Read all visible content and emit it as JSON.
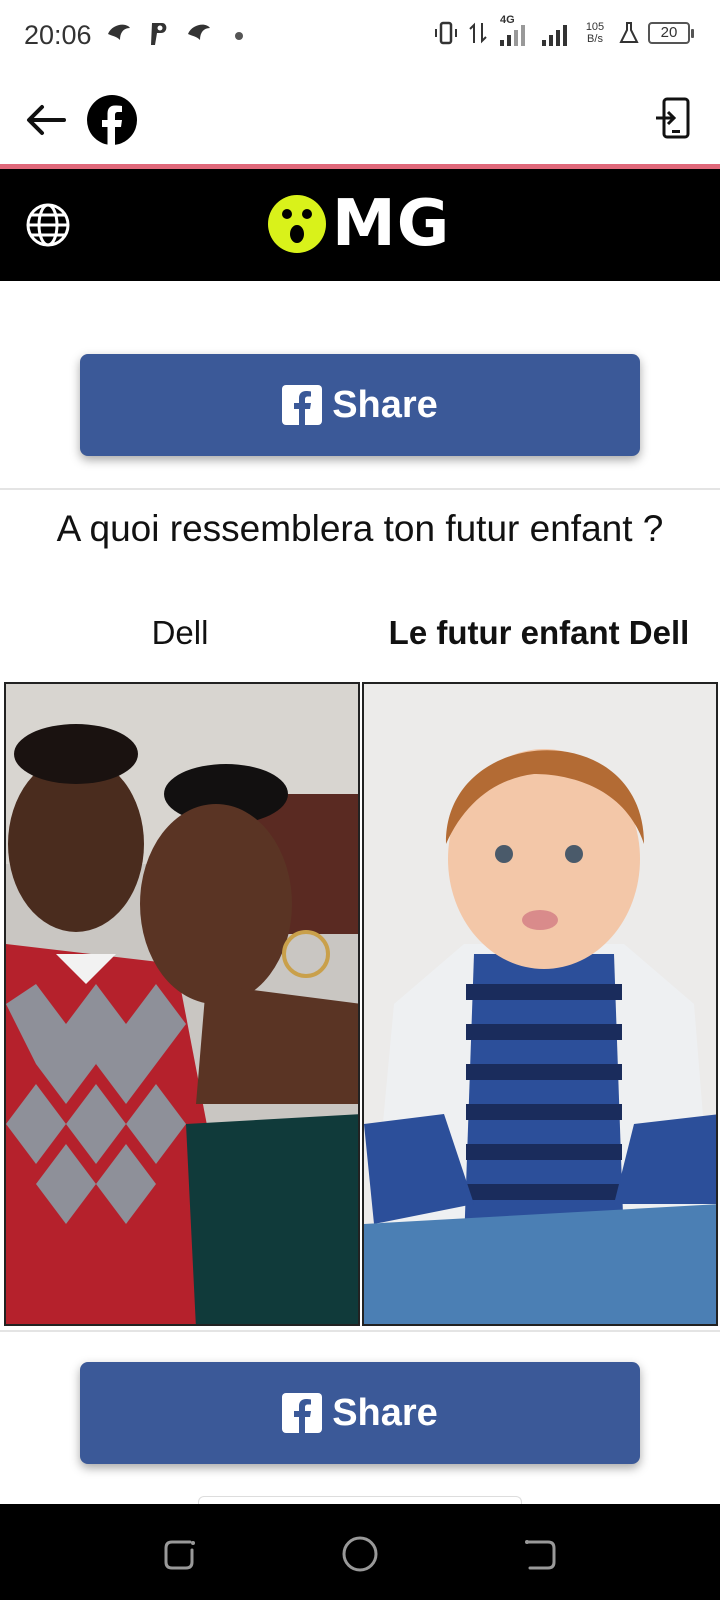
{
  "status_bar": {
    "time": "20:06",
    "network_type": "4G",
    "speed_value": "105",
    "speed_unit": "B/s",
    "battery": "20"
  },
  "app_bar": {
    "back_icon": "arrow-left-icon",
    "app_icon": "facebook-icon",
    "open_in_app_icon": "open-external-icon"
  },
  "site_header": {
    "logo_text": "MG",
    "logo_face_color": "#d9f21a",
    "background": "#000000",
    "language_icon": "globe-icon"
  },
  "share_top": {
    "label": "Share"
  },
  "share_bottom": {
    "label": "Share"
  },
  "quiz": {
    "question": "A quoi ressemblera ton futur enfant ?",
    "left_label": "Dell",
    "right_label": "Le futur enfant Dell",
    "left_image": "couple-photo",
    "right_image": "child-photo"
  },
  "colors": {
    "facebook_blue": "#3b5998",
    "accent_line": "#e0687a"
  },
  "nav_bar": {
    "recent_icon": "recent-apps-icon",
    "home_icon": "home-circle-icon",
    "back_icon": "back-nav-icon"
  }
}
